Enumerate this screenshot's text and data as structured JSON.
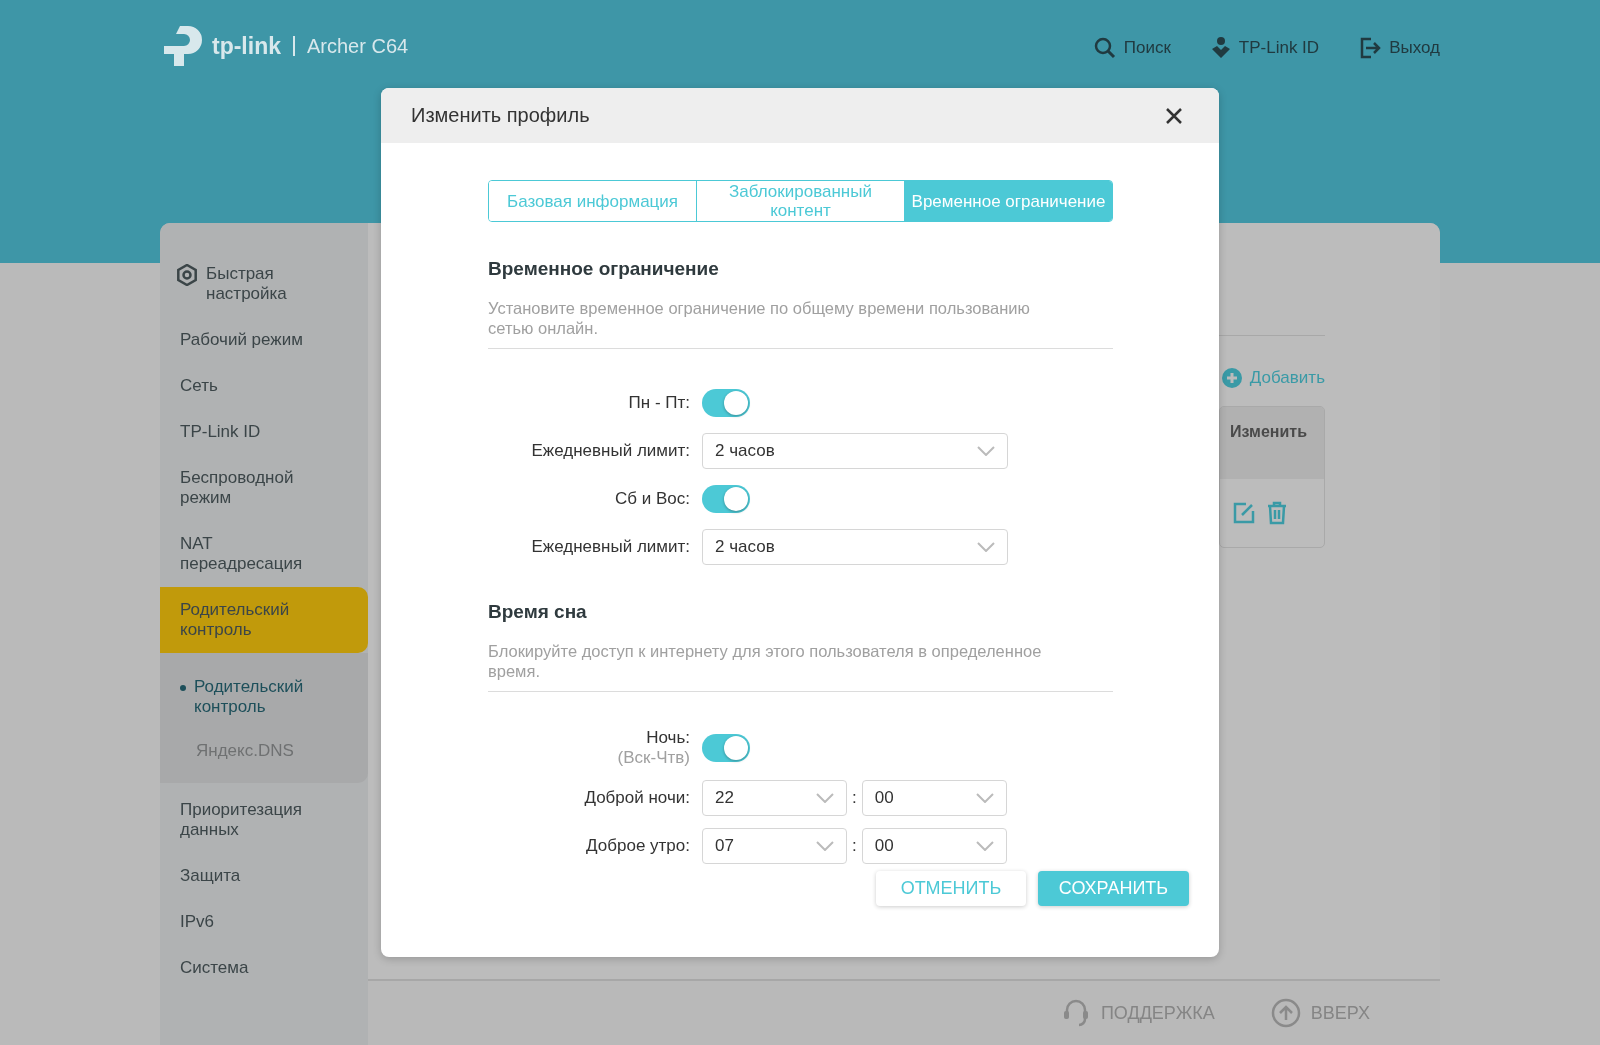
{
  "header": {
    "brand": "tp-link",
    "model": "Archer C64",
    "nav": [
      {
        "kind": "search",
        "label": "Поиск"
      },
      {
        "kind": "id",
        "label": "TP-Link ID"
      },
      {
        "kind": "logout",
        "label": "Выход"
      }
    ]
  },
  "sidebar": {
    "items": [
      {
        "label": "Быстрая настройка",
        "kind": "gear",
        "selected": false
      },
      {
        "label": "Рабочий режим",
        "selected": false
      },
      {
        "label": "Сеть",
        "selected": false
      },
      {
        "label": "TP-Link ID",
        "selected": false
      },
      {
        "label": "Беспроводной режим",
        "selected": false
      },
      {
        "label": "NAT переадресация",
        "selected": false
      },
      {
        "label": "Родительский контроль",
        "selected": true,
        "expanded": true,
        "children": [
          {
            "label": "Родительский контроль",
            "selected": true
          },
          {
            "label": "Яндекс.DNS",
            "selected": false
          }
        ]
      },
      {
        "label": "Приоритезация данных",
        "selected": false
      },
      {
        "label": "Защита",
        "selected": false
      },
      {
        "label": "IPv6",
        "selected": false
      },
      {
        "label": "Система",
        "selected": false
      }
    ]
  },
  "background_page": {
    "add_button": "Добавить",
    "table_header": "Изменить"
  },
  "footer": {
    "links": [
      {
        "kind": "support",
        "label": "ПОДДЕРЖКА"
      },
      {
        "kind": "up",
        "label": "ВВЕРХ"
      }
    ]
  },
  "dialog": {
    "title": "Изменить профиль",
    "tabs": [
      {
        "label": "Базовая информация",
        "selected": false
      },
      {
        "label": "Заблокированный контент",
        "selected": false
      },
      {
        "label": "Временное ограничение",
        "selected": true
      }
    ],
    "sections": [
      {
        "heading": "Временное ограничение",
        "description": "Установите временное ограничение по общему времени пользованию сетью онлайн.",
        "rows": [
          {
            "kind": "toggle",
            "label": "Пн - Пт:",
            "on": true
          },
          {
            "kind": "select",
            "label": "Ежедневный лимит:",
            "value": "2 часов"
          },
          {
            "kind": "toggle",
            "label": "Сб и Вос:",
            "on": true
          },
          {
            "kind": "select",
            "label": "Ежедневный лимит:",
            "value": "2 часов"
          }
        ]
      },
      {
        "heading": "Время сна",
        "description": "Блокируйте доступ к интернету для этого пользователя в определенное время.",
        "rows": [
          {
            "kind": "toggle",
            "label": "Ночь:",
            "sublabel": "(Вск-Чтв)",
            "on": true
          },
          {
            "kind": "time",
            "label": "Доброй ночи:",
            "hour": "22",
            "separator": ":",
            "minute": "00"
          },
          {
            "kind": "time",
            "label": "Доброе утро:",
            "hour": "07",
            "separator": ":",
            "minute": "00"
          }
        ]
      }
    ],
    "buttons": [
      {
        "kind": "secondary",
        "label": "ОТМЕНИТЬ"
      },
      {
        "kind": "primary",
        "label": "СОХРАНИТЬ"
      }
    ]
  }
}
